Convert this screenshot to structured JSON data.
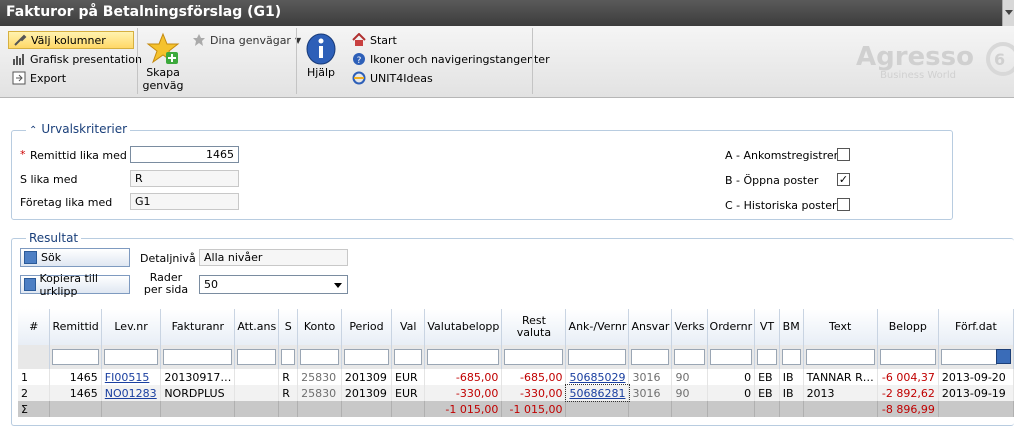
{
  "window": {
    "title": "Fakturor på Betalningsförslag (G1)"
  },
  "ribbon": {
    "choose_columns": "Välj kolumner",
    "graphic_presentation": "Grafisk presentation",
    "export": "Export",
    "create_shortcut": "Skapa genväg",
    "my_shortcuts": "Dina genvägar",
    "help": "Hjälp",
    "start": "Start",
    "icons_keys": "Ikoner och navigeringstangenter",
    "unit4ideas": "UNIT4Ideas",
    "logo": "Agresso",
    "logo_sub": "Business World",
    "logo_badge": "6"
  },
  "criteria": {
    "legend": "Urvalskriterier",
    "required_mark": "*",
    "remit_label": "Remittid lika med",
    "remit_value": "1465",
    "s_label": "S lika med",
    "s_value": "R",
    "company_label": "Företag lika med",
    "company_value": "G1",
    "option_a_label": "A - Ankomstregistrerat",
    "option_a_checked": "",
    "option_b_label": "B - Öppna poster",
    "option_b_checked": "✓",
    "option_c_label": "C - Historiska poster",
    "option_c_checked": ""
  },
  "result": {
    "legend": "Resultat",
    "search_btn": "Sök",
    "copy_btn": "Kopiera till urklipp",
    "detail_label": "Detaljnivå",
    "detail_value": "Alla nivåer",
    "rows_label": "Rader per sida",
    "rows_value": "50"
  },
  "grid": {
    "headers": [
      "#",
      "Remittid",
      "Lev.nr",
      "Fakturanr",
      "Att.ans",
      "S",
      "Konto",
      "Period",
      "Val",
      "Valutabelopp",
      "Rest valuta",
      "Ank-/Vernr",
      "Ansvar",
      "Verks",
      "Ordernr",
      "VT",
      "BM",
      "Text",
      "Belopp",
      "Förf.dat"
    ],
    "rows": [
      [
        "1",
        "1465",
        "FI00515",
        "20130917…",
        "",
        "R",
        "25830",
        "201309",
        "EUR",
        "-685,00",
        "-685,00",
        "50685029",
        "3016",
        "90",
        "0",
        "EB",
        "IB",
        "TANNAR R…",
        "-6 004,37",
        "2013-09-20"
      ],
      [
        "2",
        "1465",
        "NO01283",
        "NORDPLUS",
        "",
        "R",
        "25830",
        "201309",
        "EUR",
        "-330,00",
        "-330,00",
        "50686281",
        "3016",
        "90",
        "0",
        "EB",
        "IB",
        "2013",
        "-2 892,62",
        "2013-09-19"
      ]
    ],
    "sum_symbol": "Σ",
    "sum_valutabelopp": "-1 015,00",
    "sum_rest": "-1 015,00",
    "sum_belopp": "-8 896,99"
  }
}
